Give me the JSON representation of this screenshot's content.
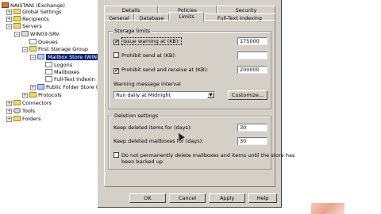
{
  "tree": {
    "root": "NAISTANI (Exchange)",
    "global_settings": "Global Settings",
    "recipients": "Recipients",
    "servers": "Servers",
    "server": "WIN03-SRV",
    "queues": "Queues",
    "storage_group": "First Storage Group",
    "mailbox_store": "Mailbox Store (WIN",
    "logons": "Logons",
    "mailboxes": "Mailboxes",
    "fulltext": "Full-Text Indexin",
    "public_folder_store": "Public Folder Store (",
    "protocols": "Protocols",
    "connectors": "Connectors",
    "tools": "Tools",
    "folders": "Folders"
  },
  "tabs": {
    "row1": [
      "Details",
      "Policies",
      "Security"
    ],
    "row2": [
      "General",
      "Database",
      "Limits",
      "Full-Text Indexing"
    ],
    "active": "Limits"
  },
  "storage_limits": {
    "title": "Storage limits",
    "issue_warning": {
      "label": "Issue warning at (KB):",
      "checked": true,
      "value": "175000"
    },
    "prohibit_send": {
      "label": "Prohibit send at (KB):",
      "checked": false,
      "value": ""
    },
    "prohibit_send_receive": {
      "label": "Prohibit send and receive at (KB):",
      "checked": true,
      "value": "200000"
    },
    "warning_interval_label": "Warning message interval",
    "warning_interval_value": "Run daily at Midnight",
    "customize_label": "Customize..."
  },
  "deletion": {
    "title": "Deletion settings",
    "items_label": "Keep deleted items for (days):",
    "items_value": "30",
    "mailboxes_label": "Keep deleted mailboxes for (days):",
    "mailboxes_value": "30",
    "dont_delete_line1": "Do not permanently delete mailboxes and items until the store has",
    "dont_delete_line2": "been backed up",
    "dont_delete_checked": false
  },
  "buttons": {
    "ok": "OK",
    "cancel": "Cancel",
    "apply": "Apply",
    "help": "Help"
  },
  "icons": {
    "expand": "plus-sign",
    "collapse": "minus-sign",
    "checkmark": "✔",
    "dropdown": "▼"
  }
}
